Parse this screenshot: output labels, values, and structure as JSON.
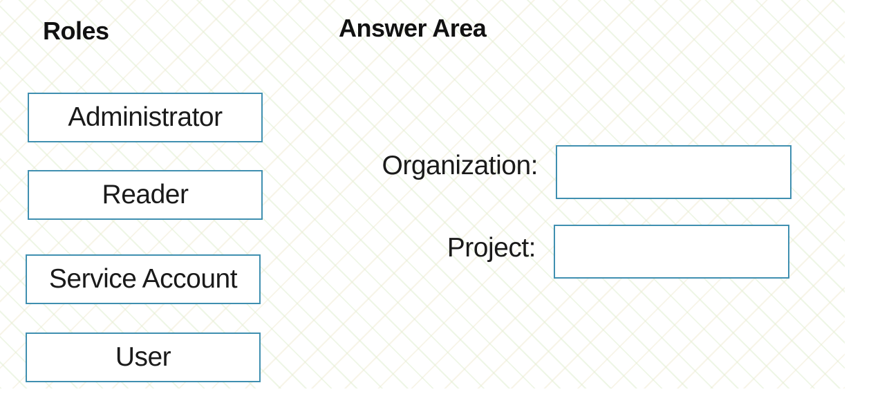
{
  "roles": {
    "heading": "Roles",
    "items": [
      {
        "label": "Administrator"
      },
      {
        "label": "Reader"
      },
      {
        "label": "Service Account"
      },
      {
        "label": "User"
      }
    ]
  },
  "answer_area": {
    "heading": "Answer Area",
    "fields": [
      {
        "label": "Organization:",
        "value": ""
      },
      {
        "label": "Project:",
        "value": ""
      }
    ]
  },
  "colors": {
    "box_border": "#3f8fb0",
    "text": "#1a1a1a"
  }
}
